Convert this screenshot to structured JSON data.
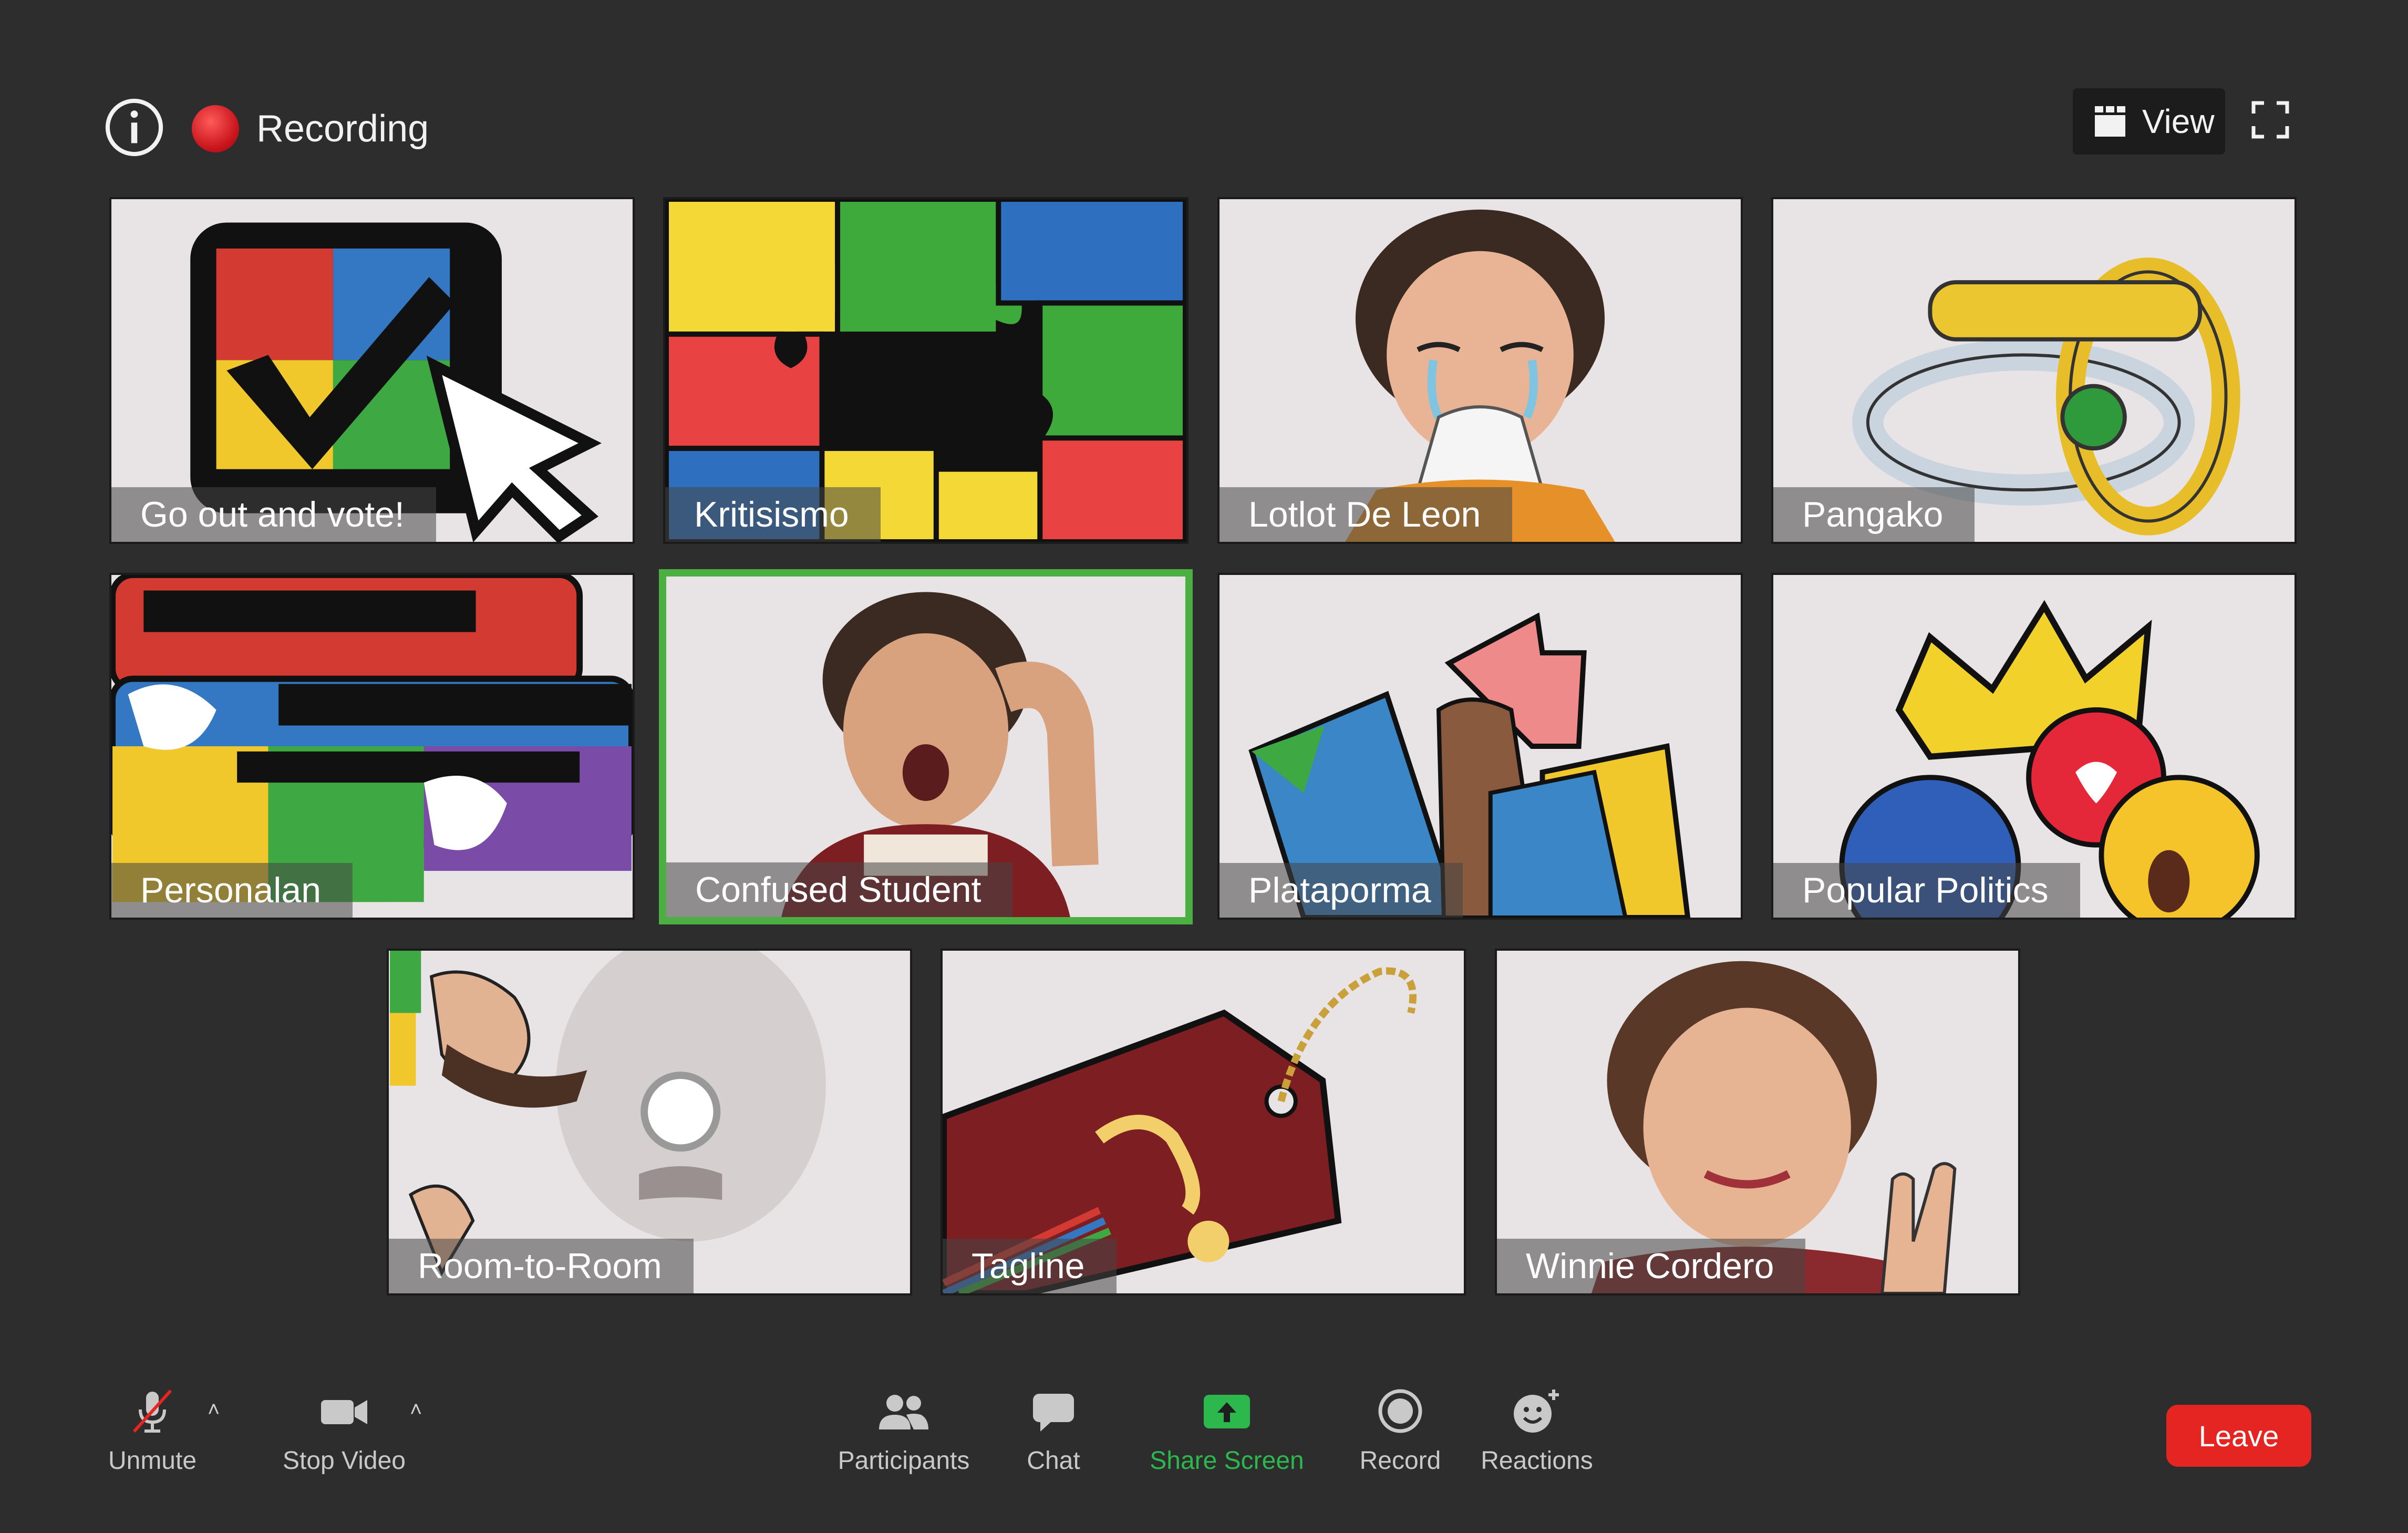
{
  "header": {
    "info_icon": "info-icon",
    "recording_label": "Recording",
    "view_label": "View",
    "fullscreen_icon": "fullscreen-icon"
  },
  "tiles": [
    {
      "name": "Go out and vote!",
      "art": "ballot-checkbox-cursor"
    },
    {
      "name": "Kritisismo",
      "art": "puzzle-pieces"
    },
    {
      "name": "Lotlot De Leon",
      "art": "crying-woman"
    },
    {
      "name": "Pangako",
      "art": "rings"
    },
    {
      "name": "Personalan",
      "art": "speech-bubbles-birds"
    },
    {
      "name": "Confused Student",
      "art": "confused-student",
      "active": true
    },
    {
      "name": "Plataporma",
      "art": "map-fists-arrow"
    },
    {
      "name": "Popular Politics",
      "art": "crown-reactions"
    },
    {
      "name": "Room-to-Room",
      "art": "upside-down-man"
    },
    {
      "name": "Tagline",
      "art": "price-tag"
    },
    {
      "name": "Winnie Cordero",
      "art": "smiling-woman-peace"
    }
  ],
  "controls": {
    "unmute": "Unmute",
    "stop_video": "Stop Video",
    "participants": "Participants",
    "chat": "Chat",
    "share_screen": "Share Screen",
    "record": "Record",
    "reactions": "Reactions",
    "leave": "Leave"
  },
  "colors": {
    "background": "#2d2d2d",
    "active_border": "#4caf42",
    "share_green": "#2db84d",
    "leave_red": "#e42521",
    "recording_red": "#c8141b"
  }
}
